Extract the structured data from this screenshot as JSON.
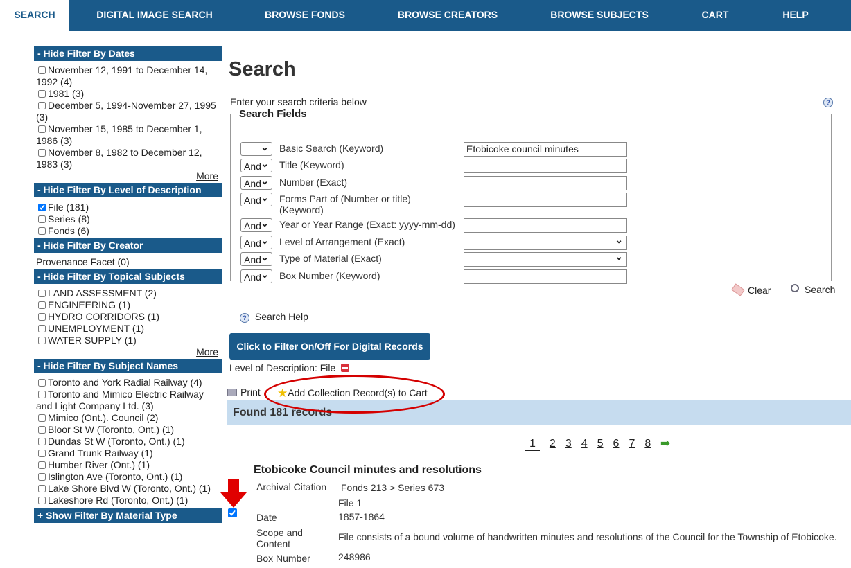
{
  "nav": {
    "tabs": [
      "SEARCH",
      "DIGITAL IMAGE SEARCH",
      "BROWSE FONDS",
      "BROWSE CREATORS",
      "BROWSE SUBJECTS",
      "CART",
      "HELP"
    ]
  },
  "filters": {
    "dates": {
      "title": "- Hide Filter By Dates",
      "items": [
        "November 12, 1991 to December 14, 1992 (4)",
        "1981 (3)",
        "December 5, 1994-November 27, 1995 (3)",
        "November 15, 1985 to December 1, 1986 (3)",
        "November 8, 1982 to December 12, 1983 (3)"
      ],
      "more": "More"
    },
    "level": {
      "title": "- Hide Filter By Level of Description",
      "items": [
        "File (181)",
        "Series (8)",
        "Fonds (6)"
      ]
    },
    "creator": {
      "title": "- Hide Filter By Creator",
      "text": "Provenance Facet (0)"
    },
    "topical": {
      "title": "- Hide Filter By Topical Subjects",
      "items": [
        "LAND ASSESSMENT (2)",
        "ENGINEERING (1)",
        "HYDRO CORRIDORS (1)",
        "UNEMPLOYMENT (1)",
        "WATER SUPPLY (1)"
      ],
      "more": "More"
    },
    "names": {
      "title": "- Hide Filter By Subject Names",
      "items": [
        "Toronto and York Radial Railway (4)",
        "Toronto and Mimico Electric Railway and Light Company Ltd. (3)",
        "Mimico (Ont.). Council (2)",
        "Bloor St W (Toronto, Ont.) (1)",
        "Dundas St W (Toronto, Ont.) (1)",
        "Grand Trunk Railway (1)",
        "Humber River (Ont.) (1)",
        "Islington Ave (Toronto, Ont.) (1)",
        "Lake Shore Blvd W (Toronto, Ont.) (1)",
        "Lakeshore Rd (Toronto, Ont.) (1)"
      ]
    },
    "material": {
      "title": "+ Show Filter By Material Type"
    }
  },
  "main": {
    "heading": "Search",
    "criteria": "Enter your search criteria below",
    "help_glyph": "?",
    "legend": "Search Fields",
    "fields": [
      {
        "op": "",
        "label": "Basic Search  (Keyword)",
        "value": ""
      },
      {
        "op": "And",
        "label": "Title  (Keyword)",
        "value": ""
      },
      {
        "op": "And",
        "label": "Number  (Exact)",
        "value": ""
      },
      {
        "op": "And",
        "label": "Forms Part of (Number or title)  (Keyword)",
        "value": ""
      },
      {
        "op": "And",
        "label": "Year or Year Range  (Exact: yyyy-mm-dd)",
        "value": ""
      },
      {
        "op": "And",
        "label": "Level of Arrangement  (Exact)",
        "value": ""
      },
      {
        "op": "And",
        "label": "Type of Material  (Exact)",
        "value": ""
      },
      {
        "op": "And",
        "label": "Box Number  (Keyword)",
        "value": ""
      }
    ],
    "basic_value": "Etobicoke council minutes",
    "clear": "Clear",
    "search": "Search",
    "search_help": "Search Help",
    "digital_button": "Click to Filter On/Off For Digital Records",
    "level_desc": "Level of Description: File",
    "print": "Print",
    "add_cart": "Add Collection Record(s) to Cart",
    "found": "Found 181 records",
    "pages": [
      "1",
      "2",
      "3",
      "4",
      "5",
      "6",
      "7",
      "8"
    ]
  },
  "record": {
    "title": "Etobicoke Council minutes and resolutions",
    "citation_label": "Archival Citation",
    "citation_value": "Fonds 213   > Series 673",
    "citation_value2": "File 1",
    "date_label": "Date",
    "date_value": "1857-1864",
    "scope_label": "Scope and Content",
    "scope_value": "File consists of a bound volume of handwritten minutes and resolutions of the Council for the Township of Etobicoke.",
    "box_label": "Box Number",
    "box_value": "248986"
  },
  "colors": {
    "nav": "#1a5a8a",
    "found_bar": "#c6dcef",
    "annotation": "#d40000"
  }
}
